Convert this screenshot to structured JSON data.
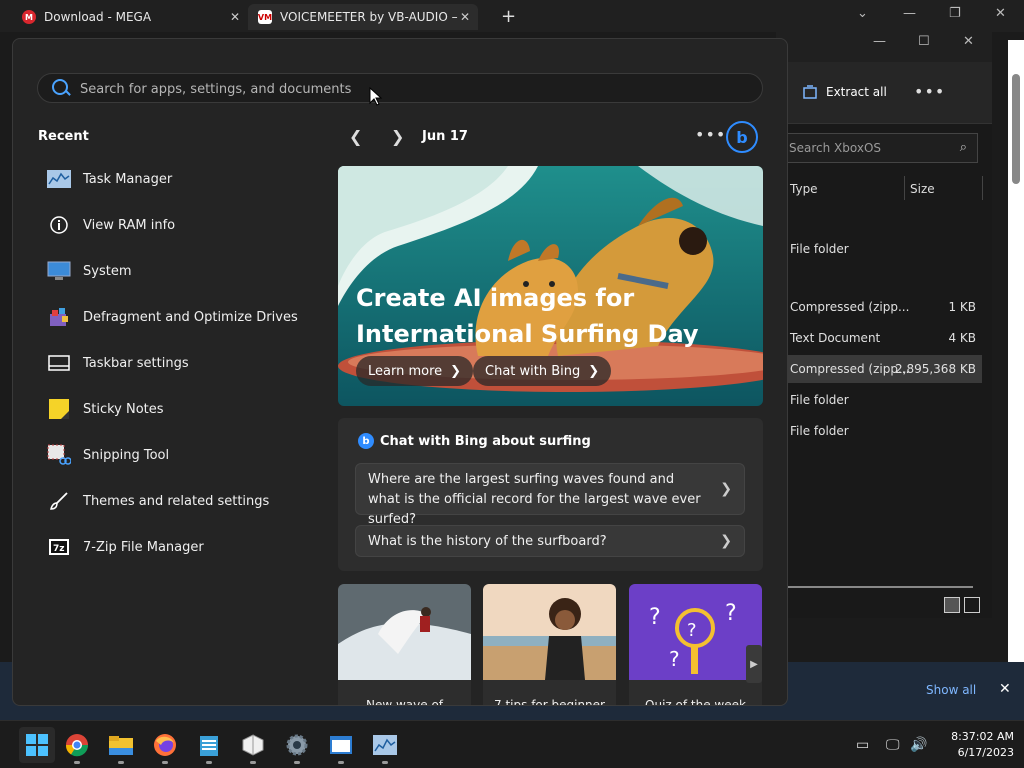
{
  "browser": {
    "tabs": [
      {
        "title": "Download - MEGA",
        "icon": "mega-icon"
      },
      {
        "title": "VOICEMEETER by VB-AUDIO – Tl",
        "icon": "voicemeeter-icon"
      }
    ],
    "new_tab_label": "+",
    "close_label": "✕"
  },
  "explorer": {
    "extract_all": "Extract all",
    "search_placeholder": "Search XboxOS",
    "columns": [
      "Type",
      "Size"
    ],
    "rows": [
      {
        "type": "File folder",
        "size": ""
      },
      {
        "type": "Compressed (zipp...",
        "size": "1 KB"
      },
      {
        "type": "Text Document",
        "size": "4 KB"
      },
      {
        "type": "Compressed (zipp...",
        "size": "2,895,368 KB"
      },
      {
        "type": "File folder",
        "size": ""
      },
      {
        "type": "File folder",
        "size": ""
      }
    ]
  },
  "search": {
    "placeholder": "Search for apps, settings, and documents"
  },
  "recent": {
    "title": "Recent",
    "items": [
      {
        "label": "Task Manager",
        "icon": "task-manager-icon"
      },
      {
        "label": "View RAM info",
        "icon": "info-icon"
      },
      {
        "label": "System",
        "icon": "system-icon"
      },
      {
        "label": "Defragment and Optimize Drives",
        "icon": "defrag-icon"
      },
      {
        "label": "Taskbar settings",
        "icon": "taskbar-settings-icon"
      },
      {
        "label": "Sticky Notes",
        "icon": "sticky-notes-icon"
      },
      {
        "label": "Snipping Tool",
        "icon": "snipping-tool-icon"
      },
      {
        "label": "Themes and related settings",
        "icon": "brush-icon"
      },
      {
        "label": "7-Zip File Manager",
        "icon": "7zip-icon"
      }
    ]
  },
  "highlights": {
    "date": "Jun 17",
    "hero_title": "Create AI images for International Surfing Day",
    "learn_more": "Learn more",
    "chat_with_bing": "Chat with Bing",
    "chat_card_title": "Chat with Bing about surfing",
    "questions": [
      "Where are the largest surfing waves found and what is the official record for the largest wave ever surfed?",
      "What is the history of the surfboard?"
    ],
    "news": [
      {
        "caption": "New wave of"
      },
      {
        "caption": "7 tips for beginner"
      },
      {
        "caption": "Quiz of the week"
      }
    ]
  },
  "notification": {
    "show_all": "Show all"
  },
  "clock": {
    "time": "8:37:02 AM",
    "date": "6/17/2023"
  },
  "colors": {
    "accent": "#2f8cff"
  }
}
